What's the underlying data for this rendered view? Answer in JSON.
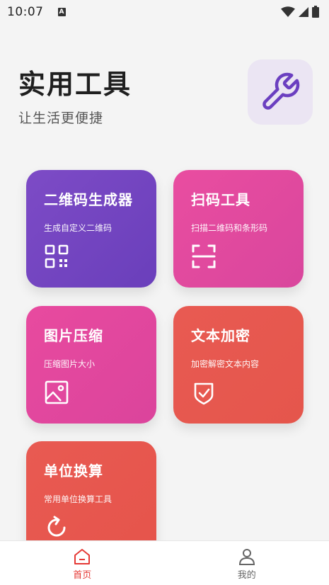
{
  "status_bar": {
    "time": "10:07",
    "notification_glyph": "A"
  },
  "header": {
    "title": "实用工具",
    "subtitle": "让生活更便捷",
    "icon": "wrench-icon"
  },
  "cards": [
    {
      "title": "二维码生成器",
      "desc": "生成自定义二维码",
      "icon": "qr-code-icon"
    },
    {
      "title": "扫码工具",
      "desc": "扫描二维码和条形码",
      "icon": "scan-frame-icon"
    },
    {
      "title": "图片压缩",
      "desc": "压缩图片大小",
      "icon": "image-icon"
    },
    {
      "title": "文本加密",
      "desc": "加密解密文本内容",
      "icon": "shield-check-icon"
    },
    {
      "title": "单位换算",
      "desc": "常用单位换算工具",
      "icon": "refresh-icon"
    }
  ],
  "nav": {
    "home_label": "首页",
    "me_label": "我的",
    "active_color": "#e53935",
    "inactive_color": "#666666"
  }
}
